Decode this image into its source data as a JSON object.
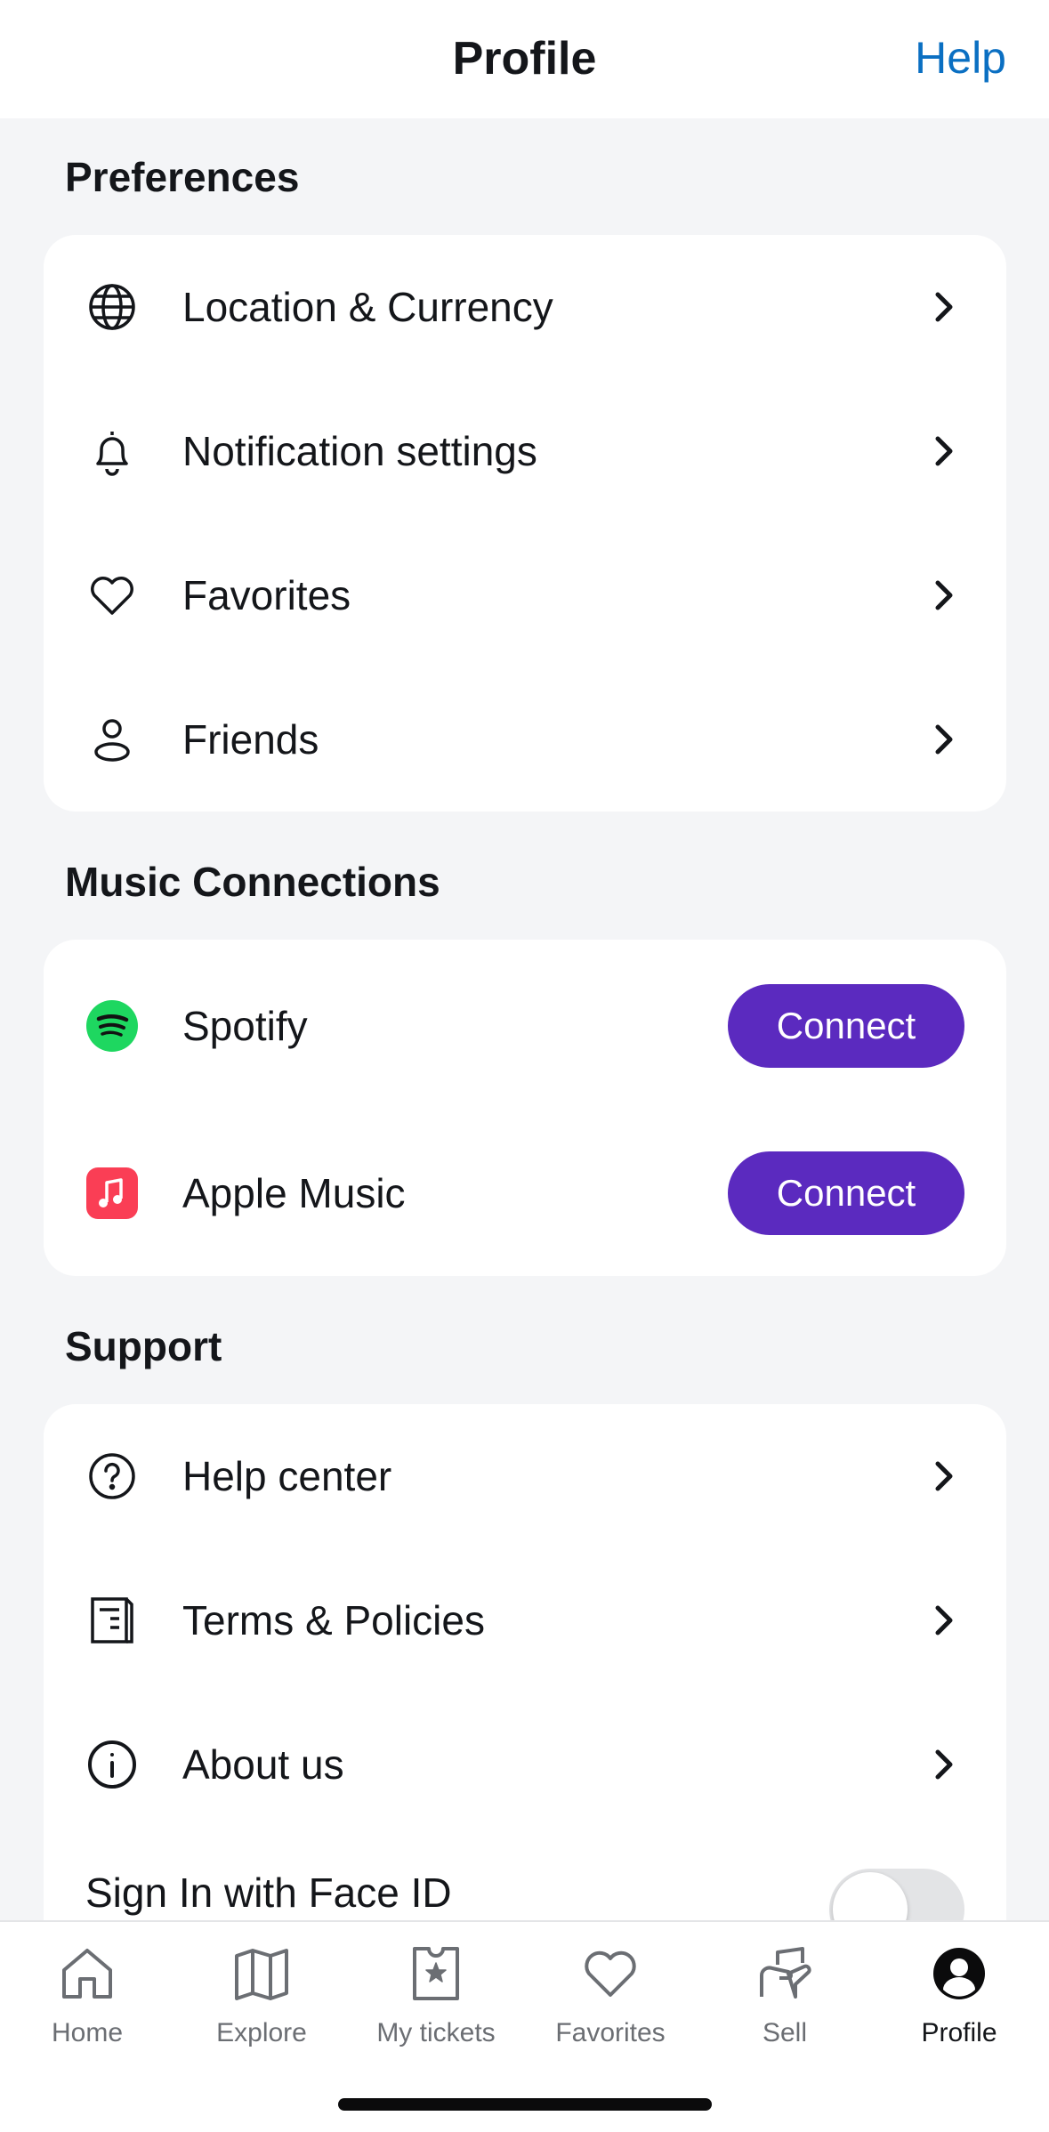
{
  "header": {
    "title": "Profile",
    "help_label": "Help"
  },
  "preferences": {
    "title": "Preferences",
    "items": [
      {
        "label": "Location & Currency",
        "icon": "globe-icon"
      },
      {
        "label": "Notification settings",
        "icon": "bell-icon"
      },
      {
        "label": "Favorites",
        "icon": "heart-icon"
      },
      {
        "label": "Friends",
        "icon": "person-icon"
      }
    ]
  },
  "music": {
    "title": "Music Connections",
    "items": [
      {
        "label": "Spotify",
        "icon": "spotify-icon",
        "button_label": "Connect"
      },
      {
        "label": "Apple Music",
        "icon": "apple-music-icon",
        "button_label": "Connect"
      }
    ]
  },
  "support": {
    "title": "Support",
    "items": [
      {
        "label": "Help center",
        "icon": "question-circle-icon"
      },
      {
        "label": "Terms & Policies",
        "icon": "document-icon"
      },
      {
        "label": "About us",
        "icon": "info-circle-icon"
      }
    ],
    "face_id": {
      "label": "Sign In with Face ID",
      "enabled": false
    }
  },
  "tabbar": {
    "tabs": [
      {
        "label": "Home",
        "icon": "home-icon",
        "active": false
      },
      {
        "label": "Explore",
        "icon": "map-icon",
        "active": false
      },
      {
        "label": "My tickets",
        "icon": "ticket-icon",
        "active": false
      },
      {
        "label": "Favorites",
        "icon": "heart-icon",
        "active": false
      },
      {
        "label": "Sell",
        "icon": "hand-ticket-icon",
        "active": false
      },
      {
        "label": "Profile",
        "icon": "profile-icon",
        "active": true
      }
    ]
  },
  "colors": {
    "accent_blue": "#0a6fc2",
    "connect_purple": "#5b2abf",
    "spotify_green": "#1ed760",
    "apple_music_red": "#fa3e55",
    "background": "#f4f5f7"
  }
}
